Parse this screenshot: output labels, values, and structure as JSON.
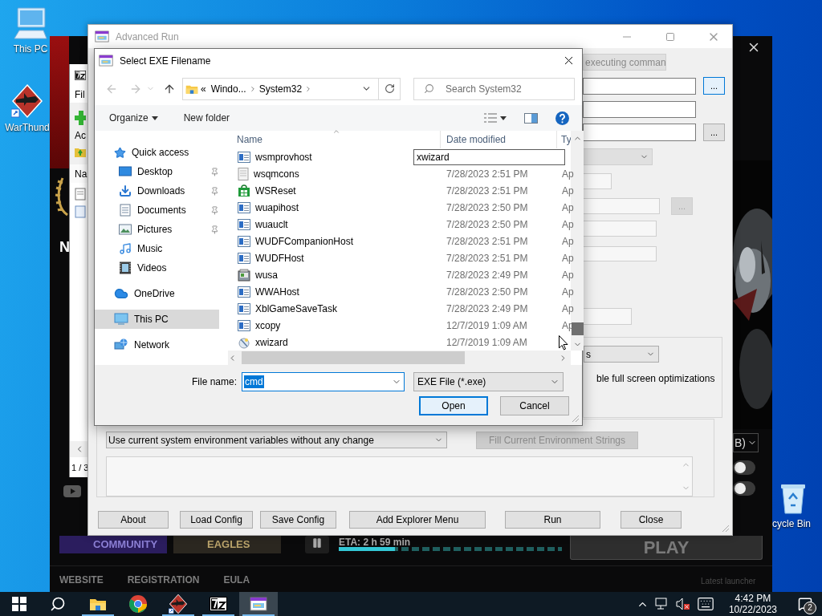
{
  "desktop_icons": [
    {
      "label": "This PC",
      "kind": "computer"
    },
    {
      "label": "WarThund",
      "kind": "jet"
    },
    {
      "label": "cycle Bin",
      "kind": "bin"
    }
  ],
  "launcher": {
    "side_letter": "N",
    "options_dropdown": "B)",
    "toggles": [
      {
        "on": false
      },
      {
        "on": false
      }
    ],
    "tiles": [
      {
        "label": "COMMUNITY",
        "kind": "community"
      },
      {
        "label": "EAGLES",
        "kind": "eagles"
      }
    ],
    "download": {
      "eta": "ETA: 2 h 59 min",
      "level": 0.25
    },
    "play_button": "PLAY",
    "footer_links": [
      "WEBSITE",
      "REGISTRATION",
      "EULA"
    ],
    "version_note": "Latest launcher"
  },
  "archiver": {
    "menu": "Fil",
    "toolbar": "Ac",
    "column": "Na",
    "page_count": "1 / 3"
  },
  "advanced_run": {
    "title": "Advanced Run",
    "run_mode": "executing comman",
    "browse_buttons": [
      {
        "label": "...",
        "focused": true,
        "disabled": false
      },
      {
        "label": "...",
        "focused": false,
        "disabled": false
      },
      {
        "label": "...",
        "focused": false,
        "disabled": true
      }
    ],
    "options_dropdown": "s",
    "option_checkbox": "ble full screen optimizations",
    "environment_mode": "Use current system environment variables without any change",
    "fill_button": {
      "label": "Fill Current Environment Strings",
      "disabled": true
    },
    "buttons": [
      "About",
      "Load Config",
      "Save Config",
      "Add Explorer Menu",
      "Run",
      "Close"
    ]
  },
  "file_dialog": {
    "title": "Select EXE Filename",
    "path_overflow": "«",
    "path": [
      "Windo...",
      "System32"
    ],
    "search_placeholder": "Search System32",
    "organize": "Organize",
    "new_folder": "New folder",
    "nav": [
      {
        "label": "Quick access",
        "kind": "star",
        "selected": false,
        "children": [
          {
            "label": "Desktop",
            "kind": "desktop",
            "pinned": true,
            "selected": false
          },
          {
            "label": "Downloads",
            "kind": "download",
            "pinned": true,
            "selected": false
          },
          {
            "label": "Documents",
            "kind": "documents",
            "pinned": true,
            "selected": false
          },
          {
            "label": "Pictures",
            "kind": "pictures",
            "pinned": true,
            "selected": false
          },
          {
            "label": "Music",
            "kind": "music",
            "pinned": false,
            "selected": false
          },
          {
            "label": "Videos",
            "kind": "videos",
            "pinned": false,
            "selected": false
          }
        ]
      },
      {
        "label": "OneDrive",
        "kind": "cloud",
        "selected": false
      },
      {
        "label": "This PC",
        "kind": "computer",
        "selected": true
      },
      {
        "label": "Network",
        "kind": "network",
        "selected": false
      }
    ],
    "columns": [
      "Name",
      "Date modified",
      "Ty"
    ],
    "files": [
      {
        "name": "wsmprovhost",
        "kind": "app"
      },
      {
        "name": "wsqmcons",
        "kind": "plain",
        "date": "7/28/2023 2:51 PM",
        "type": "Ap"
      },
      {
        "name": "WSReset",
        "kind": "store",
        "date": "7/28/2023 2:51 PM",
        "type": "Ap"
      },
      {
        "name": "wuapihost",
        "kind": "app",
        "date": "7/28/2023 2:50 PM",
        "type": "Ap"
      },
      {
        "name": "wuauclt",
        "kind": "app",
        "date": "7/28/2023 2:50 PM",
        "type": "Ap"
      },
      {
        "name": "WUDFCompanionHost",
        "kind": "app",
        "date": "7/28/2023 2:51 PM",
        "type": "Ap"
      },
      {
        "name": "WUDFHost",
        "kind": "app",
        "date": "7/28/2023 2:51 PM",
        "type": "Ap"
      },
      {
        "name": "wusa",
        "kind": "package",
        "date": "7/28/2023 2:49 PM",
        "type": "Ap"
      },
      {
        "name": "WWAHost",
        "kind": "app",
        "date": "7/28/2023 2:50 PM",
        "type": "Ap"
      },
      {
        "name": "XblGameSaveTask",
        "kind": "app",
        "date": "7/28/2023 2:49 PM",
        "type": "Ap"
      },
      {
        "name": "xcopy",
        "kind": "app",
        "date": "12/7/2019 1:09 AM",
        "type": "Ap"
      },
      {
        "name": "xwizard",
        "kind": "wizard",
        "date": "12/7/2019 1:09 AM"
      }
    ],
    "rename_value": "xwizard",
    "file_name_label": "File name:",
    "file_name": "cmd",
    "file_type": "EXE File (*.exe)",
    "buttons": [
      {
        "label": "Open",
        "focused": true
      },
      {
        "label": "Cancel",
        "focused": false
      }
    ]
  },
  "taskbar": {
    "apps": [
      {
        "kind": "explorer",
        "running": true,
        "selected": false
      },
      {
        "kind": "chrome",
        "running": false,
        "selected": false
      },
      {
        "kind": "jet",
        "running": true,
        "selected": false
      },
      {
        "kind": "archiver",
        "running": true,
        "selected": false
      },
      {
        "kind": "runner",
        "running": true,
        "selected": true
      }
    ],
    "time": "4:42 PM",
    "date": "10/22/2023",
    "notification_count": "2"
  }
}
